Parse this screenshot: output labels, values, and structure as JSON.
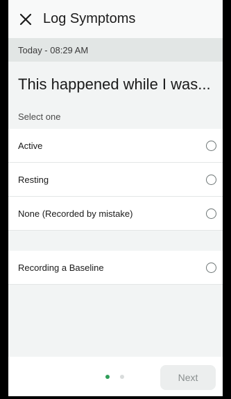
{
  "header": {
    "title": "Log Symptoms",
    "close_icon": "close-icon"
  },
  "timestamp": "Today - 08:29 AM",
  "question": "This happened while I was...",
  "select_label": "Select one",
  "options": [
    {
      "label": "Active"
    },
    {
      "label": "Resting"
    },
    {
      "label": "None (Recorded by mistake)"
    },
    {
      "label": "Recording a Baseline"
    }
  ],
  "pagination": {
    "current_page": 1,
    "total_pages": 2
  },
  "footer": {
    "next_label": "Next"
  },
  "colors": {
    "accent": "#2f9e59",
    "background": "#f2f4f4",
    "datebar": "#e2e6e5"
  }
}
